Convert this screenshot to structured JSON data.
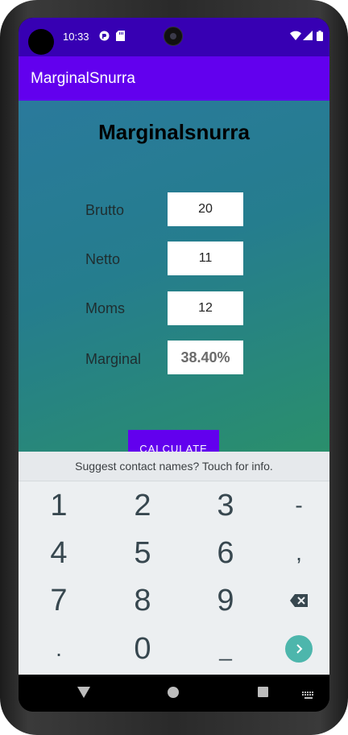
{
  "status_bar": {
    "time": "10:33"
  },
  "app_bar": {
    "title": "MarginalSnurra"
  },
  "main": {
    "heading": "Marginalsnurra",
    "rows": [
      {
        "label": "Brutto",
        "value": "20"
      },
      {
        "label": "Netto",
        "value": "11"
      },
      {
        "label": "Moms",
        "value": "12"
      },
      {
        "label": "Marginal",
        "value": "38.40%"
      }
    ],
    "calculate_label": "CALCULATE"
  },
  "keyboard": {
    "suggestion": "Suggest contact names? Touch for info.",
    "keys": [
      "1",
      "2",
      "3",
      "-",
      "4",
      "5",
      "6",
      ",",
      "7",
      "8",
      "9",
      ".",
      "0",
      "_"
    ]
  },
  "colors": {
    "status_bar": "#3700b3",
    "app_bar": "#6200ee",
    "button": "#6200ee",
    "gradient_start": "#2a7a9c",
    "gradient_end": "#2a8f6c",
    "go_key": "#4db6ac"
  },
  "icons": [
    "drive-icon",
    "sd-card-icon",
    "wifi-icon",
    "signal-icon",
    "battery-icon",
    "backspace-icon",
    "next-icon",
    "back-icon",
    "home-icon",
    "recents-icon",
    "keyboard-icon"
  ]
}
